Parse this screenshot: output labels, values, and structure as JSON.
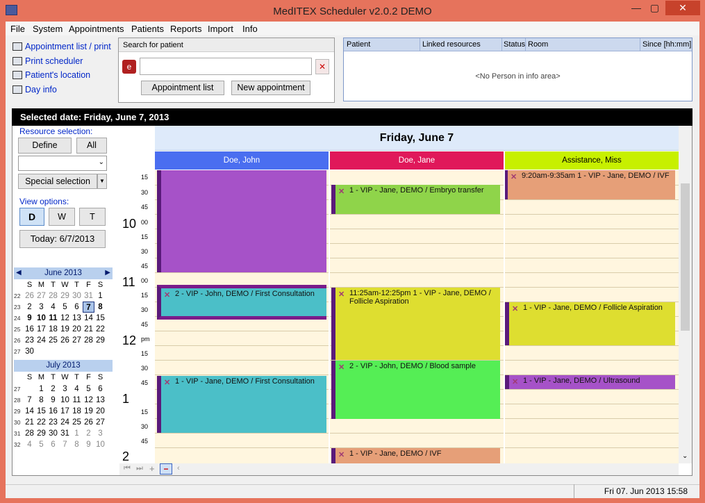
{
  "window": {
    "title": "MedITEX  Scheduler  v2.0.2 DEMO",
    "min": "—",
    "max": "▢",
    "close": "✕"
  },
  "menu": [
    "File",
    "System",
    "Appointments",
    "Patients",
    "Reports",
    "Import",
    "Info"
  ],
  "links": [
    "Appointment list / print",
    "Print scheduler",
    "Patient's location",
    "Day info"
  ],
  "search": {
    "title": "Search for patient",
    "value": "",
    "btn_list": "Appointment list",
    "btn_new": "New appointment"
  },
  "info": {
    "cols": [
      "Patient",
      "Linked resources",
      "Status",
      "Room",
      "Since [hh:mm]"
    ],
    "empty": "<No Person in info area>"
  },
  "selected_date": "Selected date: Friday, June 7, 2013",
  "left": {
    "resource_label": "Resource selection:",
    "define": "Define",
    "all": "All",
    "special": "Special selection",
    "view_label": "View options:",
    "view_d": "D",
    "view_w": "W",
    "view_t": "T",
    "today": "Today: 6/7/2013"
  },
  "calendar": {
    "june": {
      "title": "June 2013",
      "dow": [
        "S",
        "M",
        "T",
        "W",
        "T",
        "F",
        "S"
      ],
      "rows": [
        {
          "wk": "22",
          "days": [
            "26",
            "27",
            "28",
            "29",
            "30",
            "31",
            "1"
          ]
        },
        {
          "wk": "23",
          "days": [
            "2",
            "3",
            "4",
            "5",
            "6",
            "7",
            "8"
          ]
        },
        {
          "wk": "24",
          "days": [
            "9",
            "10",
            "11",
            "12",
            "13",
            "14",
            "15"
          ]
        },
        {
          "wk": "25",
          "days": [
            "16",
            "17",
            "18",
            "19",
            "20",
            "21",
            "22"
          ]
        },
        {
          "wk": "26",
          "days": [
            "23",
            "24",
            "25",
            "26",
            "27",
            "28",
            "29"
          ]
        },
        {
          "wk": "27",
          "days": [
            "30",
            "",
            "",
            "",
            "",
            "",
            ""
          ]
        }
      ]
    },
    "july": {
      "title": "July 2013",
      "dow": [
        "S",
        "M",
        "T",
        "W",
        "T",
        "F",
        "S"
      ],
      "rows": [
        {
          "wk": "27",
          "days": [
            "",
            "1",
            "2",
            "3",
            "4",
            "5",
            "6"
          ]
        },
        {
          "wk": "28",
          "days": [
            "7",
            "8",
            "9",
            "10",
            "11",
            "12",
            "13"
          ]
        },
        {
          "wk": "29",
          "days": [
            "14",
            "15",
            "16",
            "17",
            "18",
            "19",
            "20"
          ]
        },
        {
          "wk": "30",
          "days": [
            "21",
            "22",
            "23",
            "24",
            "25",
            "26",
            "27"
          ]
        },
        {
          "wk": "31",
          "days": [
            "28",
            "29",
            "30",
            "31",
            "1",
            "2",
            "3"
          ]
        },
        {
          "wk": "32",
          "days": [
            "4",
            "5",
            "6",
            "7",
            "8",
            "9",
            "10"
          ]
        }
      ]
    }
  },
  "day_header": "Friday, June 7",
  "resources": [
    {
      "name": "Doe, John",
      "color": "#4a6ef0"
    },
    {
      "name": "Doe, Jane",
      "color": "#e0185a"
    },
    {
      "name": "Assistance, Miss",
      "color": "#c7f000"
    }
  ],
  "times": {
    "h10": "10",
    "h11": "11",
    "h12": "12",
    "h1": "1",
    "h2": "2",
    "pm": "pm",
    "m00": "00",
    "m15": "15",
    "m30": "30",
    "m45": "45"
  },
  "events": {
    "john1": "",
    "john2": "2 - VIP - John, DEMO / First Consultation",
    "john3": "1 - VIP - Jane, DEMO / First Consultation",
    "jane1": "1 - VIP - Jane, DEMO / Embryo transfer",
    "jane2": "11:25am-12:25pm 1 - VIP - Jane, DEMO / Follicle Aspiration",
    "jane3": "2 - VIP - John, DEMO / Blood sample",
    "jane4": "1 - VIP - Jane, DEMO / IVF",
    "miss1": "9:20am-9:35am 1 - VIP - Jane, DEMO / IVF",
    "miss2": "1 - VIP - Jane, DEMO / Follicle Aspiration",
    "miss3": "1 - VIP - Jane, DEMO / Ultrasound"
  },
  "status": "Fri 07. Jun 2013 15:58"
}
